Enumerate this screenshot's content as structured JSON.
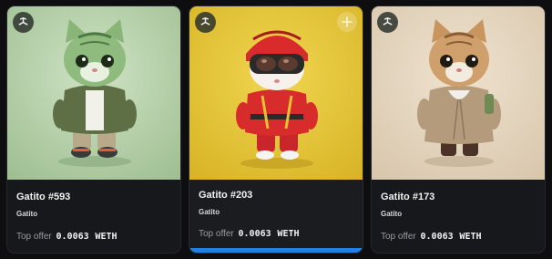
{
  "icons": {
    "chain_badge": "gnosis-chain-icon",
    "add": "plus-icon"
  },
  "colors": {
    "selected_accent": "#2081e2",
    "card_background": "#17181b",
    "page_background": "#0e0e10"
  },
  "cards": [
    {
      "title": "Gatito #593",
      "collection": "Gatito",
      "offer_label": "Top offer",
      "offer_value": "0.0063",
      "offer_unit": "WETH",
      "image_subject": "green tabby cat in olive jacket",
      "selected": false
    },
    {
      "title": "Gatito #203",
      "collection": "Gatito",
      "offer_label": "Top offer",
      "offer_value": "0.0063",
      "offer_unit": "WETH",
      "image_subject": "cat in red helmet, goggles and red suit",
      "selected": true
    },
    {
      "title": "Gatito #173",
      "collection": "Gatito",
      "offer_label": "Top offer",
      "offer_value": "0.0063",
      "offer_unit": "WETH",
      "image_subject": "tabby cat in beige trench coat",
      "selected": false
    }
  ]
}
